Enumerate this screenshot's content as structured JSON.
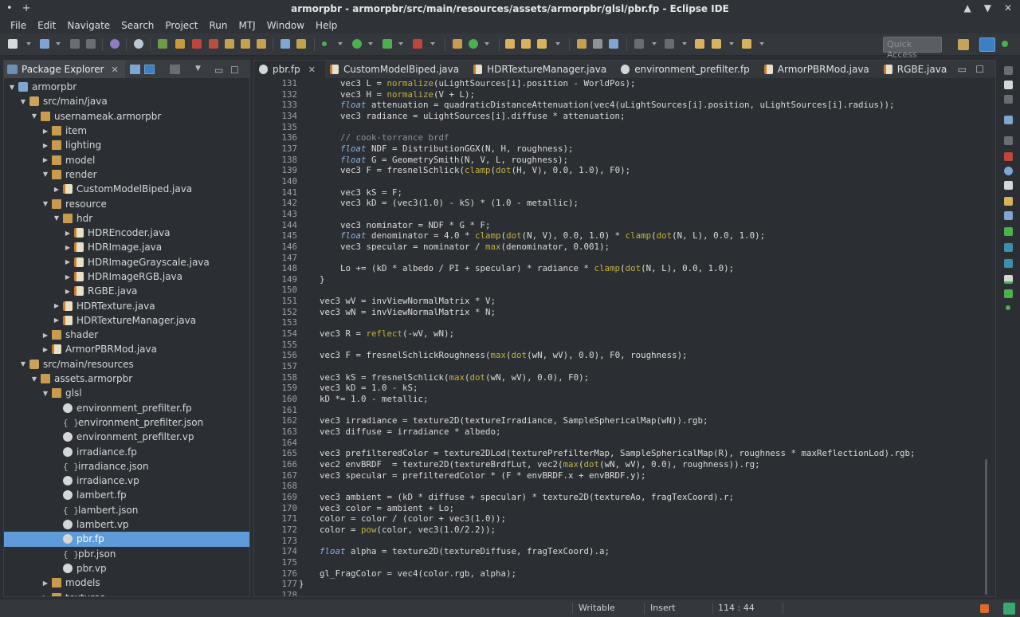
{
  "window": {
    "title": "armorpbr - armorpbr/src/main/resources/assets/armorpbr/glsl/pbr.fp - Eclipse IDE",
    "left_controls": [
      "•",
      "+"
    ],
    "right_controls": [
      "▲",
      "▼",
      "✕"
    ]
  },
  "menubar": [
    "File",
    "Edit",
    "Navigate",
    "Search",
    "Project",
    "Run",
    "MTJ",
    "Window",
    "Help"
  ],
  "toolbar": {
    "quick_access": "Quick Access"
  },
  "explorer": {
    "title": "Package Explorer",
    "close": "✕",
    "tree": [
      {
        "depth": 0,
        "arrow": "▼",
        "icon": "project",
        "label": "armorpbr"
      },
      {
        "depth": 1,
        "arrow": "▼",
        "icon": "srcfolder",
        "label": "src/main/java"
      },
      {
        "depth": 2,
        "arrow": "▼",
        "icon": "package",
        "label": "usernameak.armorpbr"
      },
      {
        "depth": 3,
        "arrow": "▶",
        "icon": "package",
        "label": "item"
      },
      {
        "depth": 3,
        "arrow": "▶",
        "icon": "package",
        "label": "lighting"
      },
      {
        "depth": 3,
        "arrow": "▶",
        "icon": "package",
        "label": "model"
      },
      {
        "depth": 3,
        "arrow": "▼",
        "icon": "package",
        "label": "render"
      },
      {
        "depth": 4,
        "arrow": "▶",
        "icon": "java",
        "label": "CustomModelBiped.java"
      },
      {
        "depth": 3,
        "arrow": "▼",
        "icon": "package",
        "label": "resource"
      },
      {
        "depth": 4,
        "arrow": "▼",
        "icon": "package",
        "label": "hdr"
      },
      {
        "depth": 5,
        "arrow": "▶",
        "icon": "java",
        "label": "HDREncoder.java"
      },
      {
        "depth": 5,
        "arrow": "▶",
        "icon": "java",
        "label": "HDRImage.java"
      },
      {
        "depth": 5,
        "arrow": "▶",
        "icon": "java",
        "label": "HDRImageGrayscale.java"
      },
      {
        "depth": 5,
        "arrow": "▶",
        "icon": "java",
        "label": "HDRImageRGB.java"
      },
      {
        "depth": 5,
        "arrow": "▶",
        "icon": "java",
        "label": "RGBE.java"
      },
      {
        "depth": 4,
        "arrow": "▶",
        "icon": "java",
        "label": "HDRTexture.java"
      },
      {
        "depth": 4,
        "arrow": "▶",
        "icon": "java",
        "label": "HDRTextureManager.java"
      },
      {
        "depth": 3,
        "arrow": "▶",
        "icon": "package",
        "label": "shader"
      },
      {
        "depth": 3,
        "arrow": "▶",
        "icon": "java",
        "label": "ArmorPBRMod.java"
      },
      {
        "depth": 1,
        "arrow": "▼",
        "icon": "srcfolder",
        "label": "src/main/resources"
      },
      {
        "depth": 2,
        "arrow": "▼",
        "icon": "package",
        "label": "assets.armorpbr"
      },
      {
        "depth": 3,
        "arrow": "▼",
        "icon": "package",
        "label": "glsl"
      },
      {
        "depth": 4,
        "arrow": "",
        "icon": "shader",
        "label": "environment_prefilter.fp"
      },
      {
        "depth": 4,
        "arrow": "",
        "icon": "json",
        "label": "environment_prefilter.json"
      },
      {
        "depth": 4,
        "arrow": "",
        "icon": "shader",
        "label": "environment_prefilter.vp"
      },
      {
        "depth": 4,
        "arrow": "",
        "icon": "shader",
        "label": "irradiance.fp"
      },
      {
        "depth": 4,
        "arrow": "",
        "icon": "json",
        "label": "irradiance.json"
      },
      {
        "depth": 4,
        "arrow": "",
        "icon": "shader",
        "label": "irradiance.vp"
      },
      {
        "depth": 4,
        "arrow": "",
        "icon": "shader",
        "label": "lambert.fp"
      },
      {
        "depth": 4,
        "arrow": "",
        "icon": "json",
        "label": "lambert.json"
      },
      {
        "depth": 4,
        "arrow": "",
        "icon": "shader",
        "label": "lambert.vp"
      },
      {
        "depth": 4,
        "arrow": "",
        "icon": "shader",
        "label": "pbr.fp",
        "selected": true
      },
      {
        "depth": 4,
        "arrow": "",
        "icon": "json",
        "label": "pbr.json"
      },
      {
        "depth": 4,
        "arrow": "",
        "icon": "shader",
        "label": "pbr.vp"
      },
      {
        "depth": 3,
        "arrow": "▶",
        "icon": "package",
        "label": "models"
      },
      {
        "depth": 3,
        "arrow": "▶",
        "icon": "package",
        "label": "textures"
      }
    ]
  },
  "editor": {
    "tabs": [
      {
        "label": "pbr.fp",
        "icon": "shader",
        "active": true,
        "close": "✕"
      },
      {
        "label": "CustomModelBiped.java",
        "icon": "java"
      },
      {
        "label": "HDRTextureManager.java",
        "icon": "java"
      },
      {
        "label": "environment_prefilter.fp",
        "icon": "shader"
      },
      {
        "label": "ArmorPBRMod.java",
        "icon": "java"
      },
      {
        "label": "RGBE.java",
        "icon": "java"
      }
    ],
    "minimize": "▭",
    "maximize": "☐",
    "lines": [
      {
        "n": "131",
        "t": "        vec3 L = normalize(uLightSources[i].position - WorldPos);"
      },
      {
        "n": "132",
        "t": "        vec3 H = normalize(V + L);"
      },
      {
        "n": "133",
        "t": "        float attenuation = quadraticDistanceAttenuation(vec4(uLightSources[i].position, uLightSources[i].radius));"
      },
      {
        "n": "134",
        "t": "        vec3 radiance = uLightSources[i].diffuse * attenuation;"
      },
      {
        "n": "135",
        "t": ""
      },
      {
        "n": "136",
        "t": "        // cook-torrance brdf"
      },
      {
        "n": "137",
        "t": "        float NDF = DistributionGGX(N, H, roughness);"
      },
      {
        "n": "138",
        "t": "        float G = GeometrySmith(N, V, L, roughness);"
      },
      {
        "n": "139",
        "t": "        vec3 F = fresnelSchlick(clamp(dot(H, V), 0.0, 1.0), F0);"
      },
      {
        "n": "140",
        "t": ""
      },
      {
        "n": "141",
        "t": "        vec3 kS = F;"
      },
      {
        "n": "142",
        "t": "        vec3 kD = (vec3(1.0) - kS) * (1.0 - metallic);"
      },
      {
        "n": "143",
        "t": ""
      },
      {
        "n": "144",
        "t": "        vec3 nominator = NDF * G * F;"
      },
      {
        "n": "145",
        "t": "        float denominator = 4.0 * clamp(dot(N, V), 0.0, 1.0) * clamp(dot(N, L), 0.0, 1.0);"
      },
      {
        "n": "146",
        "t": "        vec3 specular = nominator / max(denominator, 0.001);"
      },
      {
        "n": "147",
        "t": ""
      },
      {
        "n": "148",
        "t": "        Lo += (kD * albedo / PI + specular) * radiance * clamp(dot(N, L), 0.0, 1.0);"
      },
      {
        "n": "149",
        "t": "    }"
      },
      {
        "n": "150",
        "t": ""
      },
      {
        "n": "151",
        "t": "    vec3 wV = invViewNormalMatrix * V;"
      },
      {
        "n": "152",
        "t": "    vec3 wN = invViewNormalMatrix * N;"
      },
      {
        "n": "153",
        "t": ""
      },
      {
        "n": "154",
        "t": "    vec3 R = reflect(-wV, wN);"
      },
      {
        "n": "155",
        "t": ""
      },
      {
        "n": "156",
        "t": "    vec3 F = fresnelSchlickRoughness(max(dot(wN, wV), 0.0), F0, roughness);"
      },
      {
        "n": "157",
        "t": ""
      },
      {
        "n": "158",
        "t": "    vec3 kS = fresnelSchlick(max(dot(wN, wV), 0.0), F0);"
      },
      {
        "n": "159",
        "t": "    vec3 kD = 1.0 - kS;"
      },
      {
        "n": "160",
        "t": "    kD *= 1.0 - metallic;"
      },
      {
        "n": "161",
        "t": ""
      },
      {
        "n": "162",
        "t": "    vec3 irradiance = texture2D(textureIrradiance, SampleSphericalMap(wN)).rgb;"
      },
      {
        "n": "163",
        "t": "    vec3 diffuse = irradiance * albedo;"
      },
      {
        "n": "164",
        "t": ""
      },
      {
        "n": "165",
        "t": "    vec3 prefilteredColor = texture2DLod(texturePrefilterMap, SampleSphericalMap(R), roughness * maxReflectionLod).rgb;"
      },
      {
        "n": "166",
        "t": "    vec2 envBRDF  = texture2D(textureBrdfLut, vec2(max(dot(wN, wV), 0.0), roughness)).rg;"
      },
      {
        "n": "167",
        "t": "    vec3 specular = prefilteredColor * (F * envBRDF.x + envBRDF.y);"
      },
      {
        "n": "168",
        "t": ""
      },
      {
        "n": "169",
        "t": "    vec3 ambient = (kD * diffuse + specular) * texture2D(textureAo, fragTexCoord).r;"
      },
      {
        "n": "170",
        "t": "    vec3 color = ambient + Lo;"
      },
      {
        "n": "171",
        "t": "    color = color / (color + vec3(1.0));"
      },
      {
        "n": "172",
        "t": "    color = pow(color, vec3(1.0/2.2));"
      },
      {
        "n": "173",
        "t": ""
      },
      {
        "n": "174",
        "t": "    float alpha = texture2D(textureDiffuse, fragTexCoord).a;"
      },
      {
        "n": "175",
        "t": ""
      },
      {
        "n": "176",
        "t": "    gl_FragColor = vec4(color.rgb, alpha);"
      },
      {
        "n": "177",
        "t": "}"
      },
      {
        "n": "178",
        "t": ""
      }
    ]
  },
  "statusbar": {
    "writable": "Writable",
    "insert_mode": "Insert",
    "cursor": "114 : 44"
  },
  "colors": {
    "background": "#2b2e32",
    "selection": "#5f9bd9",
    "keyword": "#8fb1dd",
    "function": "#c2b23f",
    "comment": "#8e9297"
  }
}
